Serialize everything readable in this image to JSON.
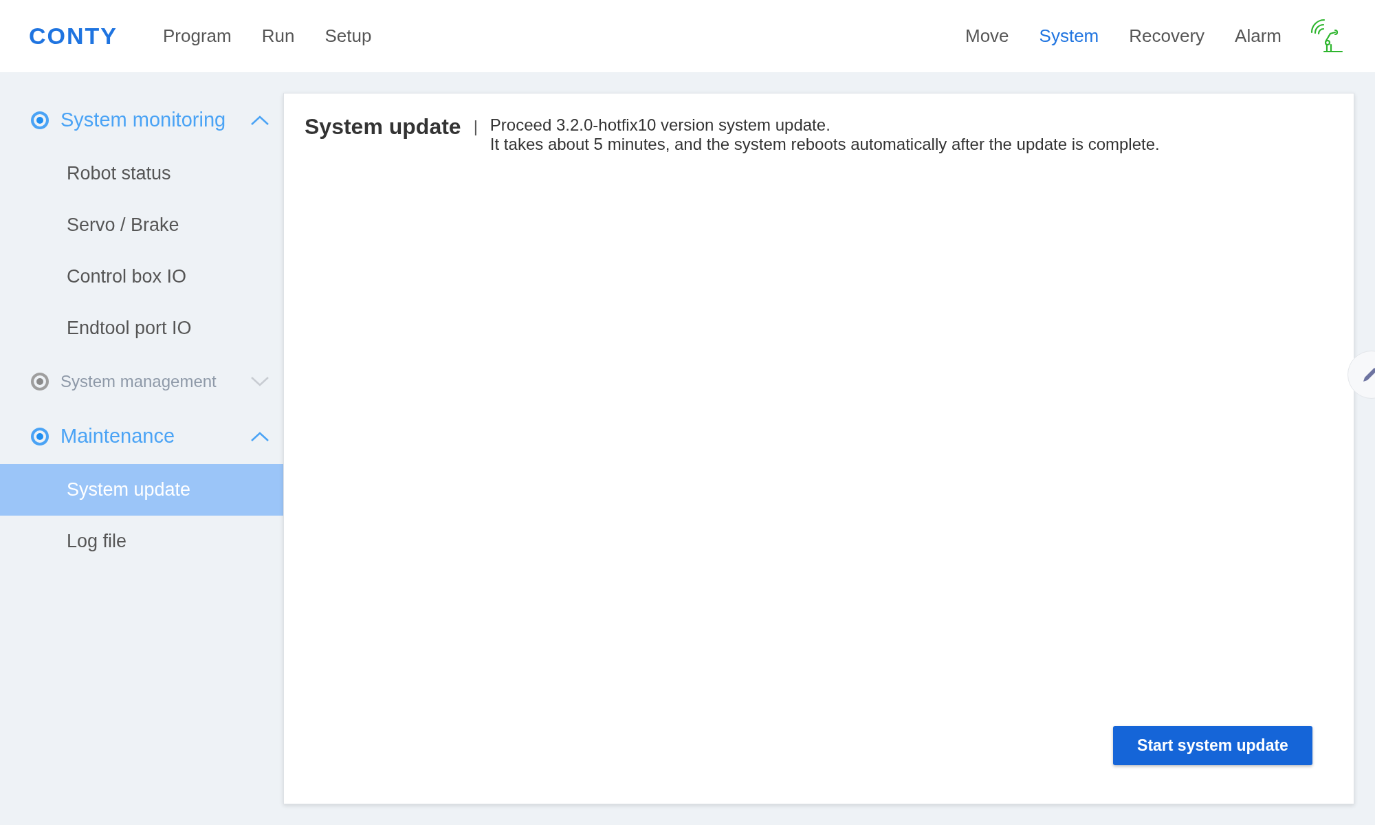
{
  "header": {
    "logo": "CONTY",
    "left_menu": [
      {
        "label": "Program",
        "selected": false
      },
      {
        "label": "Run",
        "selected": false
      },
      {
        "label": "Setup",
        "selected": false
      }
    ],
    "right_menu": [
      {
        "label": "Move",
        "selected": false
      },
      {
        "label": "System",
        "selected": true
      },
      {
        "label": "Recovery",
        "selected": false
      },
      {
        "label": "Alarm",
        "selected": false
      }
    ]
  },
  "sidebar": {
    "groups": [
      {
        "label": "System monitoring",
        "active": true,
        "expanded": true,
        "children": [
          {
            "label": "Robot status",
            "selected": false
          },
          {
            "label": "Servo / Brake",
            "selected": false
          },
          {
            "label": "Control box IO",
            "selected": false
          },
          {
            "label": "Endtool port IO",
            "selected": false
          }
        ]
      },
      {
        "label": "System management",
        "active": false,
        "expanded": false
      },
      {
        "label": "Maintenance",
        "active": true,
        "expanded": true,
        "children": [
          {
            "label": "System update",
            "selected": true
          },
          {
            "label": "Log file",
            "selected": false
          }
        ]
      }
    ]
  },
  "panel": {
    "title": "System update",
    "separator": "|",
    "lines": [
      "Proceed 3.2.0-hotfix10 version system update.",
      "It takes about 5 minutes, and the system reboots automatically after the update is complete."
    ],
    "button": "Start system update"
  }
}
